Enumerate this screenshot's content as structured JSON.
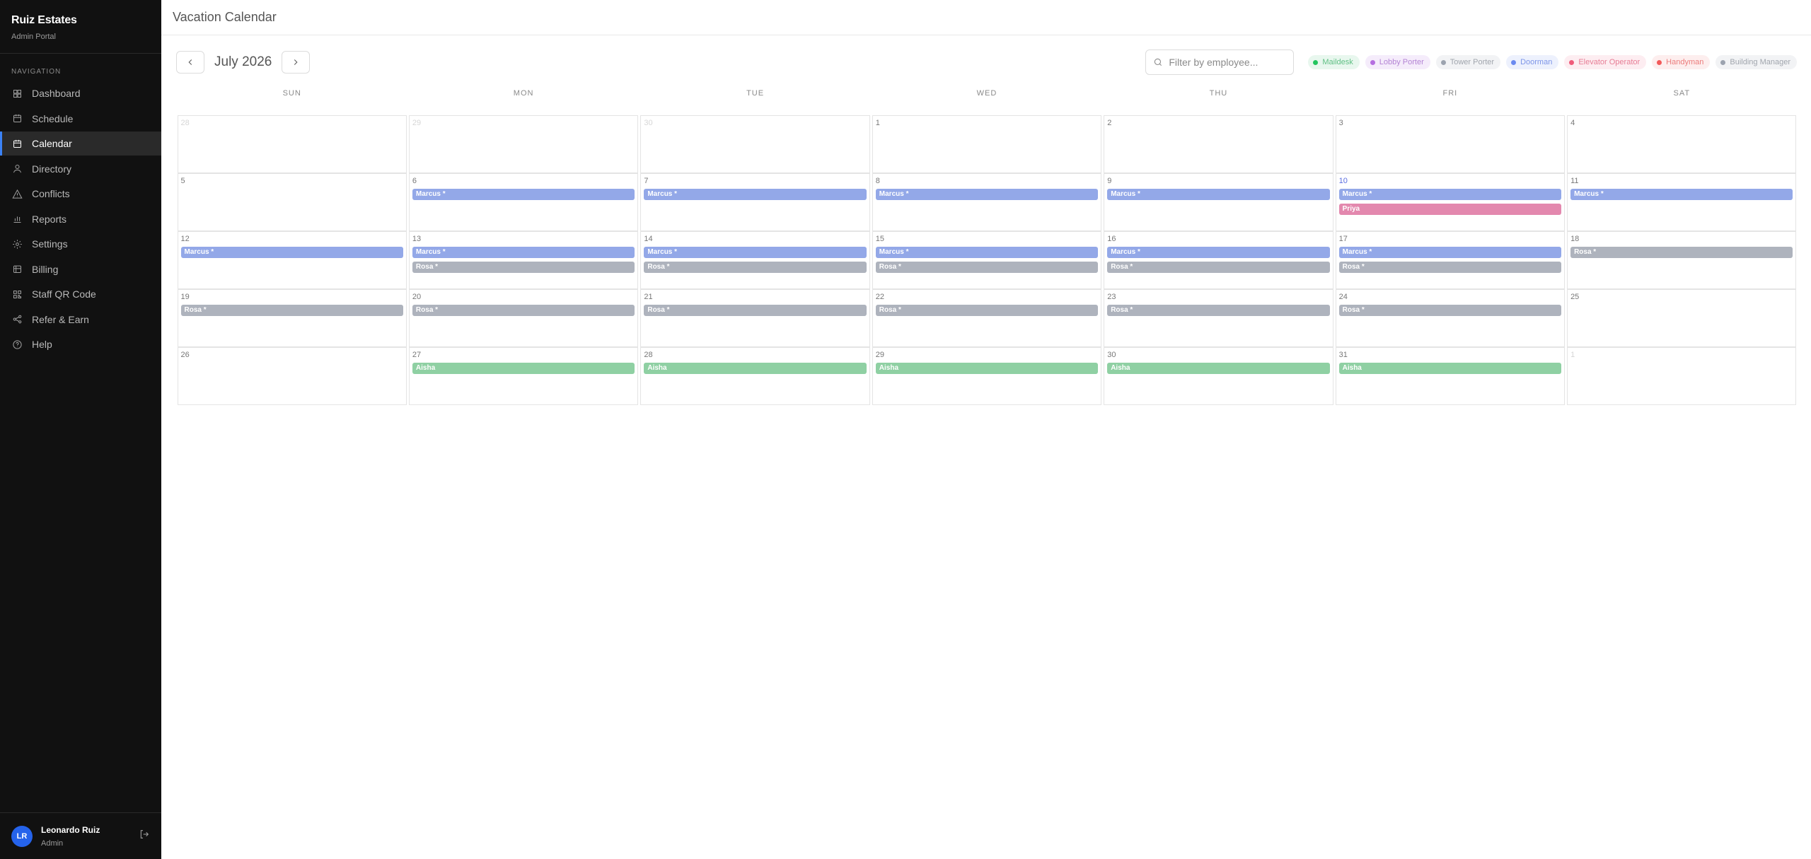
{
  "app": {
    "name": "Ruiz Estates",
    "subtitle": "Admin Portal"
  },
  "nav": {
    "label": "NAVIGATION",
    "items": [
      {
        "label": "Dashboard",
        "icon": "dashboard-icon"
      },
      {
        "label": "Schedule",
        "icon": "schedule-icon"
      },
      {
        "label": "Calendar",
        "icon": "calendar-icon",
        "active": true
      },
      {
        "label": "Directory",
        "icon": "directory-icon"
      },
      {
        "label": "Conflicts",
        "icon": "warning-icon"
      },
      {
        "label": "Reports",
        "icon": "bar-chart-icon"
      },
      {
        "label": "Settings",
        "icon": "gear-icon"
      },
      {
        "label": "Billing",
        "icon": "billing-icon"
      },
      {
        "label": "Staff QR Code",
        "icon": "qr-code-icon"
      },
      {
        "label": "Refer & Earn",
        "icon": "share-icon"
      },
      {
        "label": "Help",
        "icon": "help-icon"
      }
    ]
  },
  "user": {
    "initials": "LR",
    "name": "Leonardo Ruiz",
    "role": "Admin"
  },
  "header": {
    "title": "Vacation Calendar"
  },
  "toolbar": {
    "month": "July 2026",
    "search_placeholder": "Filter by employee..."
  },
  "legend": [
    {
      "label": "Maildesk",
      "color": "#22c55e",
      "bg": "#e8f7ee",
      "text": "#5fbf83"
    },
    {
      "label": "Lobby Porter",
      "color": "#b56ee0",
      "bg": "#f5ecfb",
      "text": "#b383d4"
    },
    {
      "label": "Tower Porter",
      "color": "#9ca3af",
      "bg": "#f2f3f5",
      "text": "#a0a5ad"
    },
    {
      "label": "Doorman",
      "color": "#6b8af0",
      "bg": "#edf1fd",
      "text": "#7d95e8"
    },
    {
      "label": "Elevator Operator",
      "color": "#ef5b7a",
      "bg": "#fdedf1",
      "text": "#e77d95"
    },
    {
      "label": "Handyman",
      "color": "#f25a5a",
      "bg": "#fdeeee",
      "text": "#ec7b7b"
    },
    {
      "label": "Building Manager",
      "color": "#9ca3af",
      "bg": "#f2f3f5",
      "text": "#a0a5ad"
    }
  ],
  "weekdays": [
    "SUN",
    "MON",
    "TUE",
    "WED",
    "THU",
    "FRI",
    "SAT"
  ],
  "colors": {
    "marcus": "#93a8e8",
    "rosa": "#aeb3bd",
    "priya": "#e388ae",
    "aisha": "#8fd0a3"
  },
  "weeks": [
    [
      {
        "day": "28",
        "other": true,
        "events": []
      },
      {
        "day": "29",
        "other": true,
        "events": []
      },
      {
        "day": "30",
        "other": true,
        "events": []
      },
      {
        "day": "1",
        "events": []
      },
      {
        "day": "2",
        "events": []
      },
      {
        "day": "3",
        "events": []
      },
      {
        "day": "4",
        "events": []
      }
    ],
    [
      {
        "day": "5",
        "events": []
      },
      {
        "day": "6",
        "events": [
          {
            "label": "Marcus *",
            "color": "marcus"
          }
        ]
      },
      {
        "day": "7",
        "events": [
          {
            "label": "Marcus *",
            "color": "marcus"
          }
        ]
      },
      {
        "day": "8",
        "events": [
          {
            "label": "Marcus *",
            "color": "marcus"
          }
        ]
      },
      {
        "day": "9",
        "events": [
          {
            "label": "Marcus *",
            "color": "marcus"
          }
        ]
      },
      {
        "day": "10",
        "friday": true,
        "events": [
          {
            "label": "Marcus *",
            "color": "marcus"
          },
          {
            "label": "Priya",
            "color": "priya"
          }
        ]
      },
      {
        "day": "11",
        "events": [
          {
            "label": "Marcus *",
            "color": "marcus"
          }
        ]
      }
    ],
    [
      {
        "day": "12",
        "events": [
          {
            "label": "Marcus *",
            "color": "marcus"
          }
        ]
      },
      {
        "day": "13",
        "events": [
          {
            "label": "Marcus *",
            "color": "marcus"
          },
          {
            "label": "Rosa *",
            "color": "rosa"
          }
        ]
      },
      {
        "day": "14",
        "events": [
          {
            "label": "Marcus *",
            "color": "marcus"
          },
          {
            "label": "Rosa *",
            "color": "rosa"
          }
        ]
      },
      {
        "day": "15",
        "events": [
          {
            "label": "Marcus *",
            "color": "marcus"
          },
          {
            "label": "Rosa *",
            "color": "rosa"
          }
        ]
      },
      {
        "day": "16",
        "events": [
          {
            "label": "Marcus *",
            "color": "marcus"
          },
          {
            "label": "Rosa *",
            "color": "rosa"
          }
        ]
      },
      {
        "day": "17",
        "events": [
          {
            "label": "Marcus *",
            "color": "marcus"
          },
          {
            "label": "Rosa *",
            "color": "rosa"
          }
        ]
      },
      {
        "day": "18",
        "events": [
          {
            "label": "Rosa *",
            "color": "rosa"
          }
        ]
      }
    ],
    [
      {
        "day": "19",
        "events": [
          {
            "label": "Rosa *",
            "color": "rosa"
          }
        ]
      },
      {
        "day": "20",
        "events": [
          {
            "label": "Rosa *",
            "color": "rosa"
          }
        ]
      },
      {
        "day": "21",
        "events": [
          {
            "label": "Rosa *",
            "color": "rosa"
          }
        ]
      },
      {
        "day": "22",
        "events": [
          {
            "label": "Rosa *",
            "color": "rosa"
          }
        ]
      },
      {
        "day": "23",
        "events": [
          {
            "label": "Rosa *",
            "color": "rosa"
          }
        ]
      },
      {
        "day": "24",
        "events": [
          {
            "label": "Rosa *",
            "color": "rosa"
          }
        ]
      },
      {
        "day": "25",
        "events": []
      }
    ],
    [
      {
        "day": "26",
        "events": []
      },
      {
        "day": "27",
        "events": [
          {
            "label": "Aisha",
            "color": "aisha"
          }
        ]
      },
      {
        "day": "28",
        "events": [
          {
            "label": "Aisha",
            "color": "aisha"
          }
        ]
      },
      {
        "day": "29",
        "events": [
          {
            "label": "Aisha",
            "color": "aisha"
          }
        ]
      },
      {
        "day": "30",
        "events": [
          {
            "label": "Aisha",
            "color": "aisha"
          }
        ]
      },
      {
        "day": "31",
        "events": [
          {
            "label": "Aisha",
            "color": "aisha"
          }
        ]
      },
      {
        "day": "1",
        "other": true,
        "events": []
      }
    ]
  ]
}
